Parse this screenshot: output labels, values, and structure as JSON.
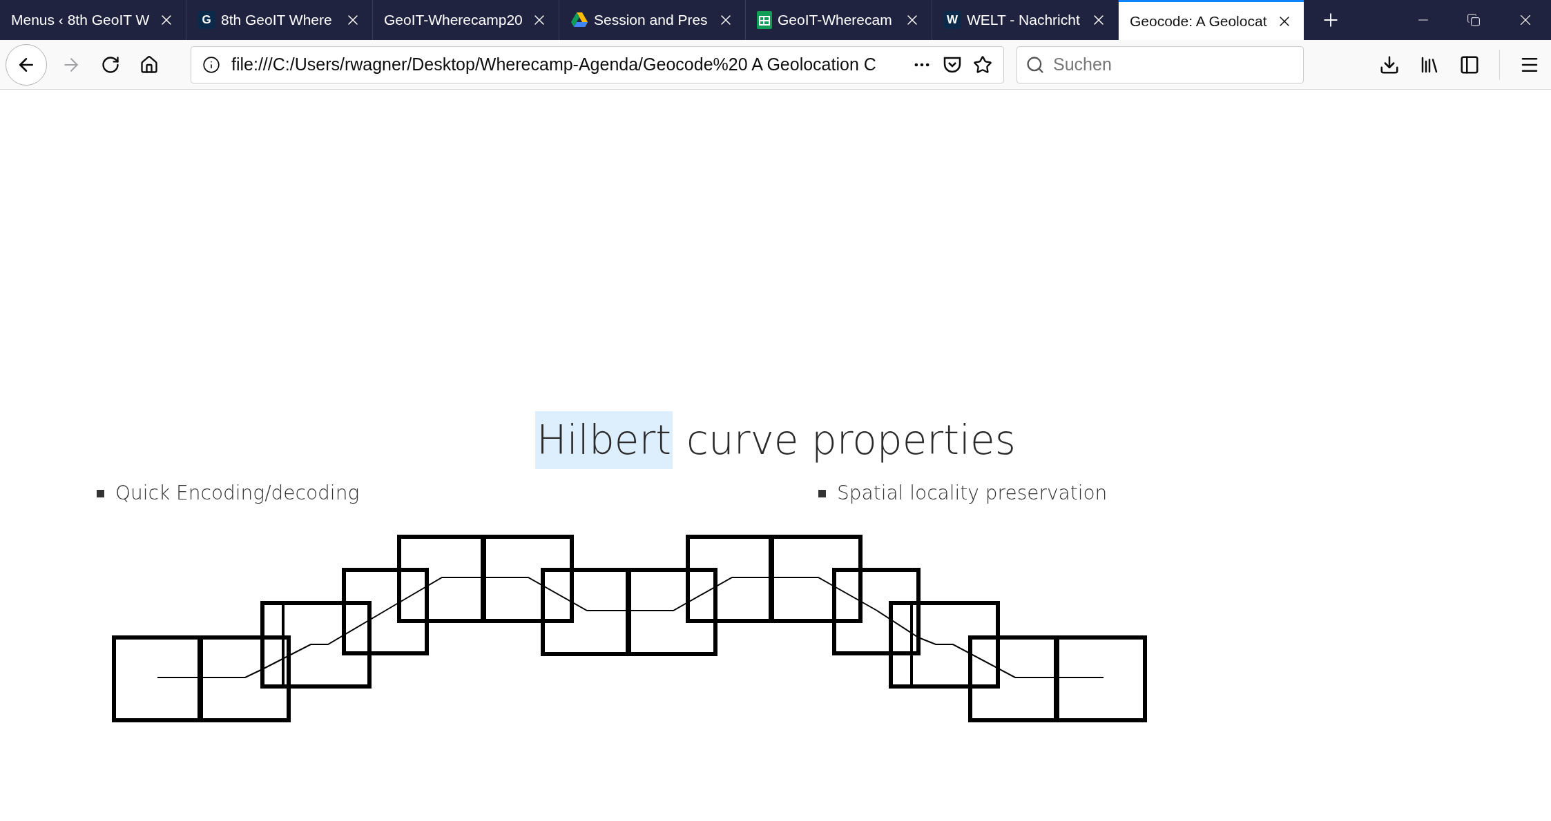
{
  "tabs": [
    {
      "title": "Menus ‹ 8th GeoIT W",
      "kind": "plain",
      "selected": false
    },
    {
      "title": "8th GeoIT Where",
      "kind": "letter",
      "letter": "G",
      "selected": false
    },
    {
      "title": "GeoIT-Wherecamp20",
      "kind": "plain",
      "selected": false
    },
    {
      "title": "Session and Pres",
      "kind": "drive",
      "selected": false
    },
    {
      "title": "GeoIT-Wherecam",
      "kind": "sheet",
      "selected": false
    },
    {
      "title": "WELT - Nachricht",
      "kind": "letter",
      "letter": "W",
      "selected": false
    },
    {
      "title": "Geocode: A Geolocat",
      "kind": "plain",
      "selected": true
    }
  ],
  "address_bar": {
    "url": "file:///C:/Users/rwagner/Desktop/Wherecamp-Agenda/Geocode%20 A Geolocation C"
  },
  "search": {
    "placeholder": "Suchen"
  },
  "slide": {
    "title_words": [
      {
        "text": "Hilbert",
        "selected": true
      },
      {
        "text": "curve properties",
        "selected": false
      }
    ],
    "bullets": [
      "Quick Encoding/decoding",
      "Spatial locality preservation"
    ]
  }
}
